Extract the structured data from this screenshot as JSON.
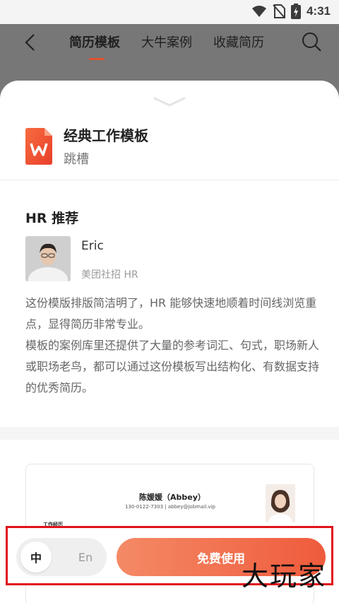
{
  "status_bar": {
    "time": "4:31"
  },
  "nav": {
    "tabs": [
      {
        "label": "简历模板"
      },
      {
        "label": "大牛案例"
      },
      {
        "label": "收藏简历"
      }
    ]
  },
  "template": {
    "title": "经典工作模板",
    "subtitle": "跳槽"
  },
  "hr": {
    "section_title": "HR 推荐",
    "name": "Eric",
    "role": "美团社招  HR",
    "review_lines": [
      "这份模版排版简洁明了，HR 能够快速地顺着时间线浏览重点，显得简历非常专业。",
      "模板的案例库里还提供了大量的参考词汇、句式，职场新人或职场老鸟，都可以通过这份模板写出结构化、有数据支持的优秀简历。"
    ]
  },
  "preview": {
    "name": "陈媛媛（Abbey）",
    "contact": "130-0122-7303 | abbey@jobmail.vip",
    "section": "工作经历"
  },
  "bottom": {
    "lang_zh": "中",
    "lang_en": "En",
    "use_button": "免费使用"
  },
  "watermark": "大玩家"
}
